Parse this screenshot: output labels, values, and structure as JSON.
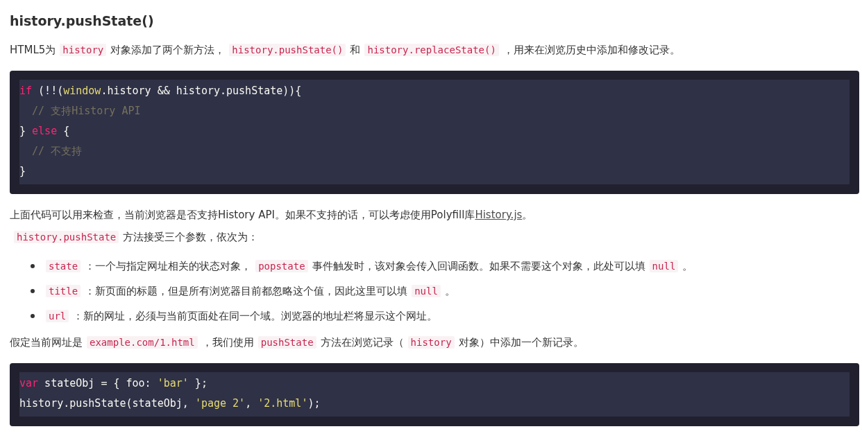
{
  "heading": "history.pushState()",
  "blocks": [
    {
      "kind": "para",
      "parts": [
        {
          "kind": "text",
          "text": "HTML5为"
        },
        {
          "kind": "code",
          "text": "history"
        },
        {
          "kind": "text",
          "text": "对象添加了两个新方法，"
        },
        {
          "kind": "code",
          "text": "history.pushState()"
        },
        {
          "kind": "text",
          "text": "和"
        },
        {
          "kind": "code",
          "text": "history.replaceState()"
        },
        {
          "kind": "text",
          "text": "，用来在浏览历史中添加和修改记录。"
        }
      ]
    },
    {
      "kind": "codeblock",
      "lines": [
        [
          {
            "kind": "keyword",
            "text": "if"
          },
          {
            "kind": "plain",
            "text": " (!!("
          },
          {
            "kind": "builtin",
            "text": "window"
          },
          {
            "kind": "plain",
            "text": ".history && history.pushState)){"
          }
        ],
        [
          {
            "kind": "comment",
            "text": "// 支持History API"
          }
        ],
        [
          {
            "kind": "plain",
            "text": "} "
          },
          {
            "kind": "keyword",
            "text": "else"
          },
          {
            "kind": "plain",
            "text": " {"
          }
        ],
        [
          {
            "kind": "comment",
            "text": "// 不支持"
          }
        ],
        [
          {
            "kind": "plain",
            "text": "}"
          }
        ]
      ]
    },
    {
      "kind": "para",
      "parts": [
        {
          "kind": "text",
          "text": "上面代码可以用来检查，当前浏览器是否支持History API。如果不支持的话，可以考虑使用Polyfill库"
        },
        {
          "kind": "link",
          "text": "History.js"
        },
        {
          "kind": "text",
          "text": "。"
        }
      ]
    },
    {
      "kind": "para",
      "parts": [
        {
          "kind": "code",
          "text": "history.pushState"
        },
        {
          "kind": "text",
          "text": "方法接受三个参数，依次为："
        }
      ]
    },
    {
      "kind": "list",
      "items": [
        [
          {
            "kind": "code",
            "text": "state"
          },
          {
            "kind": "text",
            "text": "：一个与指定网址相关的状态对象，"
          },
          {
            "kind": "code",
            "text": "popstate"
          },
          {
            "kind": "text",
            "text": "事件触发时，该对象会传入回调函数。如果不需要这个对象，此处可以填"
          },
          {
            "kind": "code",
            "text": "null"
          },
          {
            "kind": "text",
            "text": "。"
          }
        ],
        [
          {
            "kind": "code",
            "text": "title"
          },
          {
            "kind": "text",
            "text": "：新页面的标题，但是所有浏览器目前都忽略这个值，因此这里可以填"
          },
          {
            "kind": "code",
            "text": "null"
          },
          {
            "kind": "text",
            "text": "。"
          }
        ],
        [
          {
            "kind": "code",
            "text": "url"
          },
          {
            "kind": "text",
            "text": "：新的网址，必须与当前页面处在同一个域。浏览器的地址栏将显示这个网址。"
          }
        ]
      ]
    },
    {
      "kind": "para",
      "parts": [
        {
          "kind": "text",
          "text": "假定当前网址是"
        },
        {
          "kind": "code",
          "text": "example.com/1.html"
        },
        {
          "kind": "text",
          "text": "，我们使用"
        },
        {
          "kind": "code",
          "text": "pushState"
        },
        {
          "kind": "text",
          "text": "方法在浏览记录（"
        },
        {
          "kind": "code",
          "text": "history"
        },
        {
          "kind": "text",
          "text": "对象）中添加一个新记录。"
        }
      ]
    },
    {
      "kind": "codeblock",
      "lines": [
        [
          {
            "kind": "keyword",
            "text": "var"
          },
          {
            "kind": "plain",
            "text": " stateObj = { foo: "
          },
          {
            "kind": "string",
            "text": "'bar'"
          },
          {
            "kind": "plain",
            "text": " };"
          }
        ],
        [
          {
            "kind": "plain",
            "text": "history.pushState(stateObj, "
          },
          {
            "kind": "string",
            "text": "'page 2'"
          },
          {
            "kind": "plain",
            "text": ", "
          },
          {
            "kind": "string",
            "text": "'2.html'"
          },
          {
            "kind": "plain",
            "text": ");"
          }
        ]
      ]
    }
  ]
}
